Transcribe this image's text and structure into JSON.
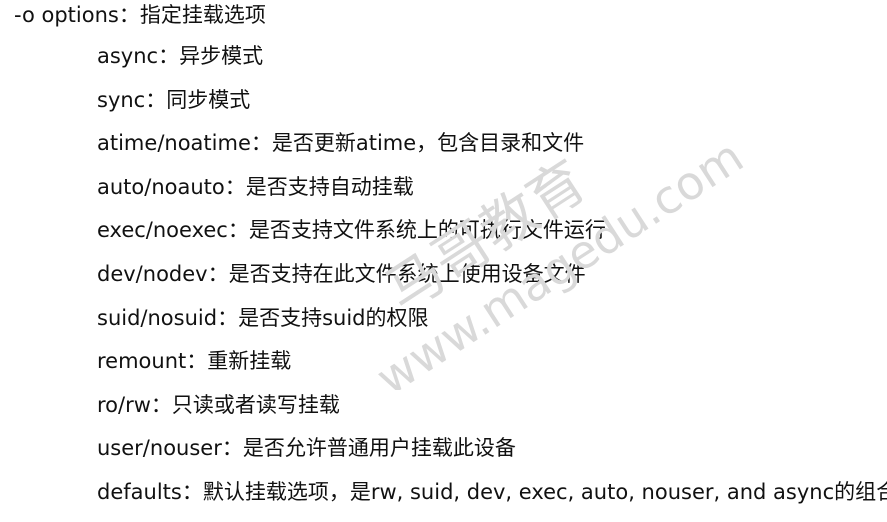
{
  "heading": "-o options：指定挂载选项",
  "options": [
    "async：异步模式",
    "sync：同步模式",
    "atime/noatime：是否更新atime，包含目录和文件",
    "auto/noauto：是否支持自动挂载",
    "exec/noexec：是否支持文件系统上的可执行文件运行",
    "dev/nodev：是否支持在此文件系统上使用设备文件",
    "suid/nosuid：是否支持suid的权限",
    "remount：重新挂载",
    "ro/rw：只读或者读写挂载",
    "user/nouser：是否允许普通用户挂载此设备",
    "defaults：默认挂载选项，是rw, suid, dev, exec, auto, nouser, and async的组合"
  ],
  "watermark": {
    "line1": "马哥教育",
    "line2": "www.magedu.com",
    "color": "#d9d9d9"
  }
}
